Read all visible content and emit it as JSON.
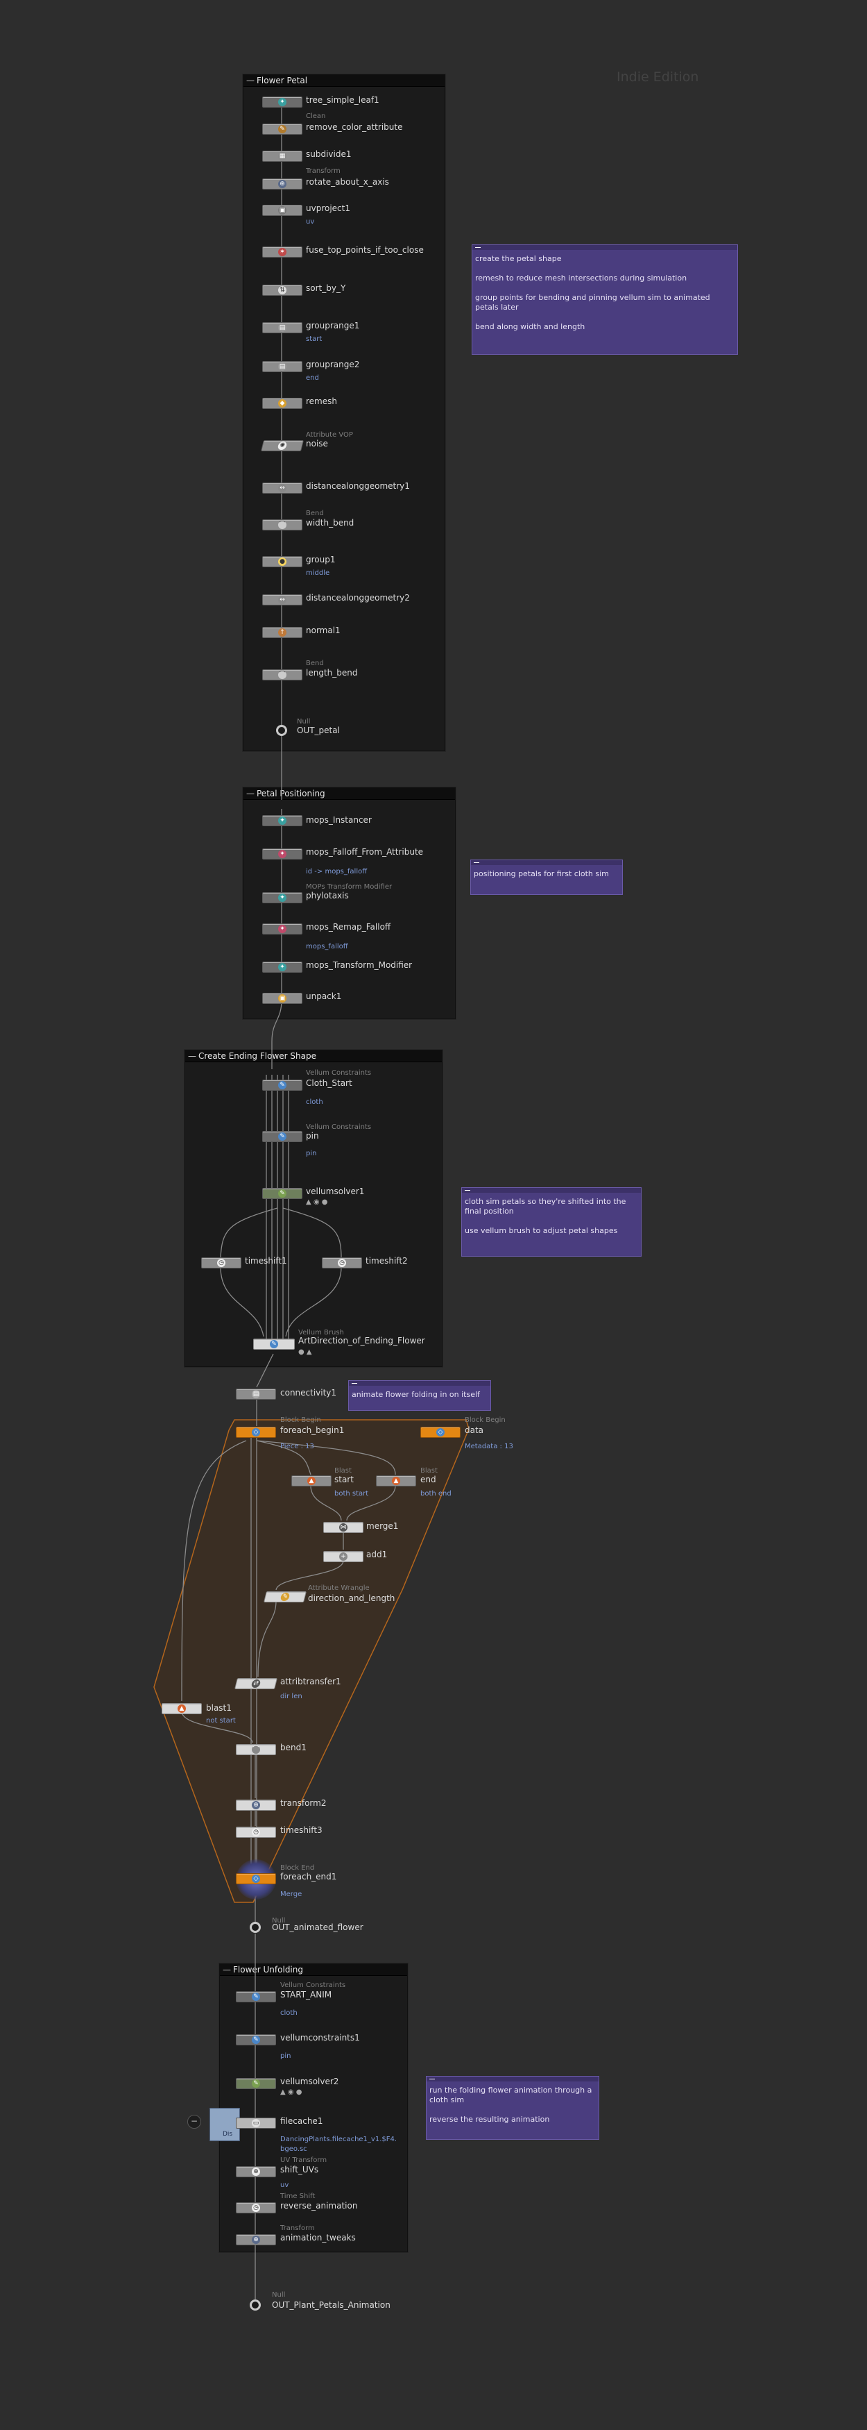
{
  "watermark": "Indie Edition",
  "boxes": {
    "flower_petal": {
      "title": "Flower Petal"
    },
    "petal_positioning": {
      "title": "Petal Positioning"
    },
    "ending_shape": {
      "title": "Create Ending Flower Shape"
    },
    "flower_unfolding": {
      "title": "Flower Unfolding"
    }
  },
  "flower_petal_nodes": [
    {
      "name": "tree_simple_leaf1",
      "type": "",
      "info": ""
    },
    {
      "name": "remove_color_attribute",
      "type": "Clean",
      "info": ""
    },
    {
      "name": "subdivide1",
      "type": "",
      "info": ""
    },
    {
      "name": "rotate_about_x_axis",
      "type": "Transform",
      "info": ""
    },
    {
      "name": "uvproject1",
      "type": "",
      "info": "uv"
    },
    {
      "name": "fuse_top_points_if_too_close",
      "type": "",
      "info": ""
    },
    {
      "name": "sort_by_Y",
      "type": "",
      "info": ""
    },
    {
      "name": "grouprange1",
      "type": "",
      "info": "start"
    },
    {
      "name": "grouprange2",
      "type": "",
      "info": "end"
    },
    {
      "name": "remesh",
      "type": "",
      "info": ""
    },
    {
      "name": "noise",
      "type": "Attribute VOP",
      "info": ""
    },
    {
      "name": "distancealonggeometry1",
      "type": "",
      "info": ""
    },
    {
      "name": "width_bend",
      "type": "Bend",
      "info": ""
    },
    {
      "name": "group1",
      "type": "",
      "info": "middle"
    },
    {
      "name": "distancealonggeometry2",
      "type": "",
      "info": ""
    },
    {
      "name": "normal1",
      "type": "",
      "info": ""
    },
    {
      "name": "length_bend",
      "type": "Bend",
      "info": ""
    },
    {
      "name": "OUT_petal",
      "type": "Null",
      "info": ""
    }
  ],
  "petal_positioning_nodes": [
    {
      "name": "mops_Instancer",
      "type": "",
      "info": ""
    },
    {
      "name": "mops_Falloff_From_Attribute",
      "type": "",
      "info": "id -> mops_falloff"
    },
    {
      "name": "phylotaxis",
      "type": "MOPs Transform Modifier",
      "info": ""
    },
    {
      "name": "mops_Remap_Falloff",
      "type": "",
      "info": "mops_falloff"
    },
    {
      "name": "mops_Transform_Modifier",
      "type": "",
      "info": ""
    },
    {
      "name": "unpack1",
      "type": "",
      "info": ""
    }
  ],
  "ending_shape_nodes": [
    {
      "name": "Cloth_Start",
      "type": "Vellum Constraints",
      "info": "cloth"
    },
    {
      "name": "pin",
      "type": "Vellum Constraints",
      "info": "pin"
    },
    {
      "name": "vellumsolver1",
      "type": "",
      "info": ""
    },
    {
      "name": "timeshift1",
      "type": "",
      "info": ""
    },
    {
      "name": "timeshift2",
      "type": "",
      "info": ""
    },
    {
      "name": "ArtDirection_of_Ending_Flower",
      "type": "Vellum Brush",
      "info": ""
    }
  ],
  "loop_nodes": {
    "connectivity1": {
      "name": "connectivity1",
      "type": ""
    },
    "foreach_begin1": {
      "name": "foreach_begin1",
      "type": "Block Begin",
      "info": "Piece : 13"
    },
    "data": {
      "name": "data",
      "type": "Block Begin",
      "info": "Metadata : 13"
    },
    "start": {
      "name": "start",
      "type": "Blast",
      "info": "both start"
    },
    "end": {
      "name": "end",
      "type": "Blast",
      "info": "both end"
    },
    "merge1": {
      "name": "merge1",
      "type": ""
    },
    "add1": {
      "name": "add1",
      "type": ""
    },
    "direction_and_length": {
      "name": "direction_and_length",
      "type": "Attribute Wrangle"
    },
    "attribtransfer1": {
      "name": "attribtransfer1",
      "type": "",
      "info": "dir len"
    },
    "blast1": {
      "name": "blast1",
      "type": "",
      "info": "not start"
    },
    "bend1": {
      "name": "bend1",
      "type": ""
    },
    "transform2": {
      "name": "transform2",
      "type": ""
    },
    "timeshift3": {
      "name": "timeshift3",
      "type": ""
    },
    "foreach_end1": {
      "name": "foreach_end1",
      "type": "Block End",
      "info": "Merge"
    },
    "OUT_animated_flower": {
      "name": "OUT_animated_flower",
      "type": "Null"
    }
  },
  "flower_unfolding_nodes": [
    {
      "name": "START_ANIM",
      "type": "Vellum Constraints",
      "info": "cloth"
    },
    {
      "name": "vellumconstraints1",
      "type": "",
      "info": "pin"
    },
    {
      "name": "vellumsolver2",
      "type": "",
      "info": ""
    },
    {
      "name": "filecache1",
      "type": "",
      "info": "DancingPlants.filecache1_v1.$F4.bgeo.sc"
    },
    {
      "name": "shift_UVs",
      "type": "UV Transform",
      "info": "uv"
    },
    {
      "name": "reverse_animation",
      "type": "Time Shift",
      "info": ""
    },
    {
      "name": "animation_tweaks",
      "type": "Transform",
      "info": ""
    },
    {
      "name": "OUT_Plant_Petals_Animation",
      "type": "Null",
      "info": ""
    }
  ],
  "filecache_panel": {
    "label": "Dis"
  },
  "sticky_notes": {
    "petal_shape": "create the petal shape\n\nremesh to reduce mesh intersections during simulation\n\ngroup points for bending and pinning vellum sim to animated petals later\n\nbend along width and length",
    "positioning": "positioning petals for first cloth sim",
    "cloth_sim": "cloth sim petals so they're shifted into the final position\n\nuse vellum brush to adjust petal shapes",
    "folding": "animate flower folding in on itself",
    "unfolding": "run the folding flower animation through a cloth sim\n\nreverse the resulting animation"
  },
  "colors": {
    "background": "#2d2d2d",
    "netbox": "#1b1b1b",
    "sticky": "#4a3d7f",
    "loop_region": "#b3651c",
    "wire": "#8a8a8a",
    "block_node": "#e48713"
  }
}
